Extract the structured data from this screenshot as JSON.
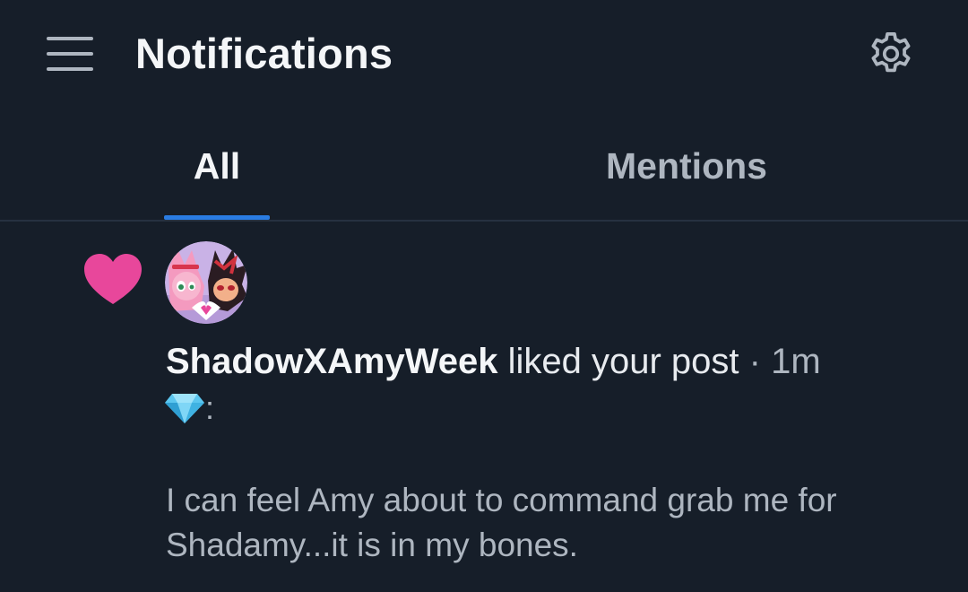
{
  "header": {
    "title": "Notifications",
    "menu_icon": "hamburger-menu-icon",
    "settings_icon": "gear-icon"
  },
  "tabs": [
    {
      "label": "All",
      "selected": true
    },
    {
      "label": "Mentions",
      "selected": false
    }
  ],
  "notification": {
    "type_icon": "heart-icon",
    "username": "ShadowXAmyWeek",
    "action": "liked your post",
    "separator": "·",
    "time": "1m",
    "post_title_emoji": "gem-icon",
    "post_title_suffix": ":",
    "post_preview": "I can feel Amy about to command grab me for Shadamy...it is in my bones."
  },
  "colors": {
    "background": "#161e29",
    "accent": "#2a7ce2",
    "heart": "#e8479b",
    "text_primary": "#f4f6f8",
    "text_secondary": "#aeb6c0",
    "divider": "#263140"
  }
}
